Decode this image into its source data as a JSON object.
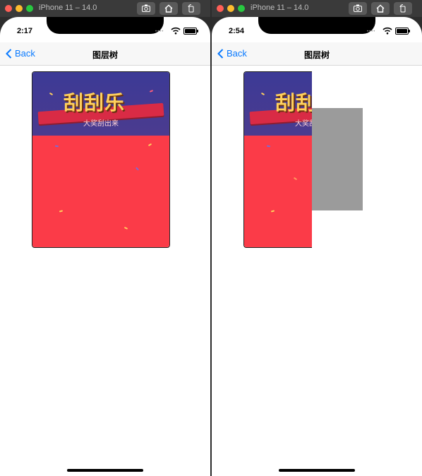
{
  "left": {
    "sim_title": "iPhone 11 – 14.0",
    "status": {
      "time": "2:17"
    },
    "nav": {
      "back_label": "Back",
      "title": "图层树"
    },
    "card": {
      "headline": "刮刮乐",
      "subline": "大奖刮出来"
    }
  },
  "right": {
    "sim_title": "iPhone 11 – 14.0",
    "status": {
      "time": "2:54"
    },
    "nav": {
      "back_label": "Back",
      "title": "图层树"
    },
    "card": {
      "headline": "刮刮乐",
      "subline": "大奖刮出来"
    }
  },
  "icons": [
    "screenshot-icon",
    "home-icon",
    "rotate-icon",
    "wifi-icon",
    "battery-icon",
    "chevron-left-icon"
  ],
  "colors": {
    "accent": "#0a7aff",
    "card_top": "#3c3a96",
    "card_bottom": "#fb3b48",
    "overlay_gray": "#9b9b9b"
  }
}
